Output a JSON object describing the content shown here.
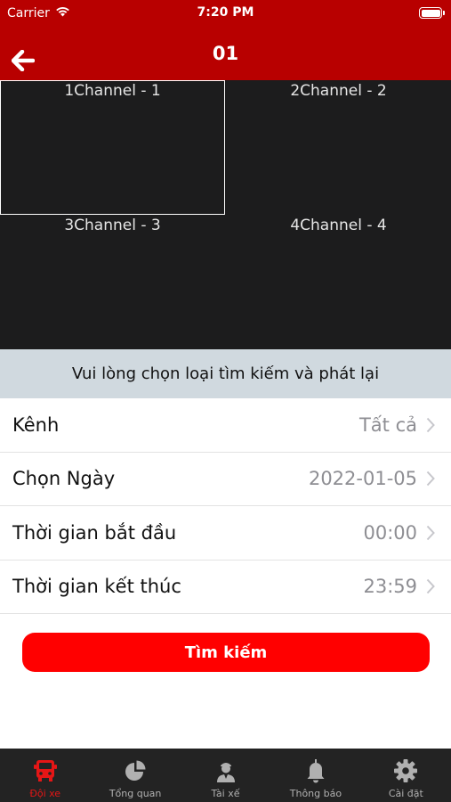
{
  "status_bar": {
    "carrier": "Carrier",
    "time": "7:20 PM"
  },
  "header": {
    "title": "01"
  },
  "channels": [
    {
      "label": "1Channel - 1"
    },
    {
      "label": "2Channel - 2"
    },
    {
      "label": "3Channel - 3"
    },
    {
      "label": "4Channel - 4"
    }
  ],
  "search_prompt": "Vui lòng chọn loại tìm kiếm và phát lại",
  "form_rows": [
    {
      "label": "Kênh",
      "value": "Tất cả"
    },
    {
      "label": "Chọn Ngày",
      "value": "2022-01-05"
    },
    {
      "label": "Thời gian bắt đầu",
      "value": "00:00"
    },
    {
      "label": "Thời gian kết thúc",
      "value": "23:59"
    }
  ],
  "search_button": "Tìm kiếm",
  "tabs": [
    {
      "label": "Đội xe",
      "icon": "truck-icon"
    },
    {
      "label": "Tổng quan",
      "icon": "pie-chart-icon"
    },
    {
      "label": "Tài xế",
      "icon": "driver-icon"
    },
    {
      "label": "Thông báo",
      "icon": "bell-icon"
    },
    {
      "label": "Cài đặt",
      "icon": "gear-icon"
    }
  ],
  "colors": {
    "header": "#b80000",
    "accent": "#ff0000",
    "tab_active": "#e51616",
    "tab_bar": "#232323",
    "video_bg": "#1c1c1d"
  }
}
